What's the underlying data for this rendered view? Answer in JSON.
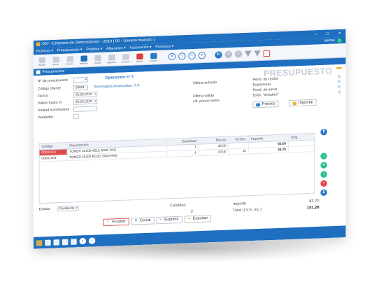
{
  "window": {
    "title": "007 - Empresa de Demostración - 2019 | 00 - Usuario maestro )",
    "minimize": "–",
    "maximize": "□",
    "close": "×"
  },
  "menu": {
    "items": [
      "Ficheros ▾",
      "Presupuestos ▾",
      "Pedidos ▾",
      "Albaranes ▾",
      "Facturación ▾",
      "Procesos ▾"
    ],
    "ventas": "Ventas"
  },
  "ribbon": {
    "labels": [
      "Añadir",
      "Borrar",
      "Cerrar",
      "Imprimir",
      "Copiar",
      "Impuesto",
      "Cambio",
      "Ayuda",
      "Usuario"
    ]
  },
  "document": {
    "tab": "Presupuestos",
    "heading": "PRESUPUESTO"
  },
  "form": {
    "num_label": "Nº de presupuesto",
    "operation": "Operación nº 7.",
    "client_label": "Código cliente",
    "client_code": "00001",
    "client_name": "Tecnologías Avanzadas, S.A.",
    "date_label": "Fecha",
    "date_value": "06.06.2019",
    "valid_label": "Válido hasta el",
    "valid_value": "06.06.2019",
    "carrier_label": "Unidad transitadora",
    "seller_label": "Vendedor",
    "last_entry": "Última entrada",
    "last_exit": "Última salida",
    "last_price": "Ult. precio venta",
    "pend_recibir": "Pend. de recibir",
    "existencias": "Existencias",
    "pend_servir": "Pend. de servir",
    "exist_virtuales": "Exist. \"virtuales\"",
    "val_recibir": "5",
    "val_existencias": "-2",
    "val_servir": "0",
    "val_virtuales": "3",
    "precios_btn": "Precios",
    "importar_btn": "Importar"
  },
  "grid": {
    "headers": [
      "Código",
      "Descripción",
      "Cantidad",
      "Precio",
      "% Dto.",
      "Importe",
      "Orig"
    ],
    "rows": [
      {
        "code": "00001002",
        "desc": "TONER 43200 AZUL 5000 PAG",
        "qty": "1",
        "price": "45,00",
        "dto": "",
        "imp": "45,00"
      },
      {
        "code": "00001003",
        "desc": "TONER 43200 ROJO 5000 PAG",
        "qty": "1",
        "price": "43,00",
        "dto": "10",
        "imp": "38,70"
      }
    ]
  },
  "footer": {
    "estado_label": "Estado",
    "estado_value": "Pendiente",
    "cantidad_label": "Cantidad",
    "cantidad_value": "2",
    "importe_label": "Importe",
    "importe_value": "83,70",
    "total_label": "Total (I.V.A. inc.)",
    "total_value": "101,28"
  },
  "buttons": {
    "aceptar": "Aceptar",
    "cerrar": "Cerrar",
    "suprimir": "Suprimir",
    "exportar": "Exportar"
  },
  "colors": {
    "accent": "#1e6fbf",
    "heading_grey": "#c4ccd7",
    "selected_row": "#e24a4a",
    "add_green": "#2bbf8f"
  }
}
